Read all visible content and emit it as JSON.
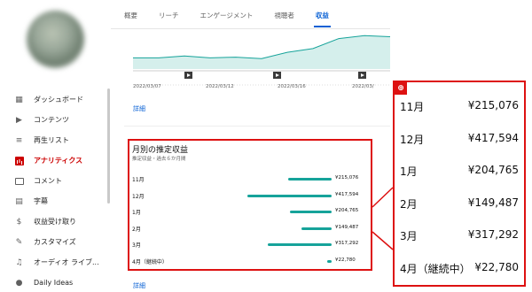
{
  "sidebar": {
    "items": [
      {
        "label": "ダッシュボード",
        "icon": "dashboard-icon"
      },
      {
        "label": "コンテンツ",
        "icon": "content-icon"
      },
      {
        "label": "再生リスト",
        "icon": "playlist-icon"
      },
      {
        "label": "アナリティクス",
        "icon": "analytics-icon",
        "active": true
      },
      {
        "label": "コメント",
        "icon": "comment-icon"
      },
      {
        "label": "字幕",
        "icon": "subtitles-icon"
      },
      {
        "label": "収益受け取り",
        "icon": "dollar-icon"
      },
      {
        "label": "カスタマイズ",
        "icon": "customize-icon"
      },
      {
        "label": "オーディオ ライブ...",
        "icon": "audio-library-icon"
      },
      {
        "label": "Daily Ideas",
        "icon": "daily-ideas-icon"
      }
    ]
  },
  "tabs": [
    {
      "label": "概要"
    },
    {
      "label": "リーチ"
    },
    {
      "label": "エンゲージメント"
    },
    {
      "label": "視聴者"
    },
    {
      "label": "収益",
      "active": true
    }
  ],
  "chart_data": {
    "type": "area",
    "x_labels": [
      "2022/03/07",
      "2022/03/12",
      "2022/03/16",
      "2022/03/"
    ],
    "series": [
      {
        "values": [
          0.3,
          0.3,
          0.35,
          0.3,
          0.32,
          0.28,
          0.45,
          0.55,
          0.82,
          0.9,
          0.87
        ]
      }
    ],
    "color": "#16a39a"
  },
  "links": {
    "detail_top": "詳細",
    "detail_bottom": "詳細"
  },
  "monthly_card": {
    "title": "月別の推定収益",
    "subtitle": "推定収益・過去６か月間",
    "max_value": 417594,
    "rows": [
      {
        "month": "11月",
        "value": "¥215,076",
        "amount": 215076
      },
      {
        "month": "12月",
        "value": "¥417,594",
        "amount": 417594
      },
      {
        "month": "1月",
        "value": "¥204,765",
        "amount": 204765
      },
      {
        "month": "2月",
        "value": "¥149,487",
        "amount": 149487
      },
      {
        "month": "3月",
        "value": "¥317,292",
        "amount": 317292
      },
      {
        "month": "4月（継続中）",
        "value": "¥22,780",
        "amount": 22780
      }
    ]
  },
  "zoom_panel": {
    "icon": "zoom-in-icon",
    "rows": [
      {
        "month": "11月",
        "value": "¥215,076"
      },
      {
        "month": "12月",
        "value": "¥417,594"
      },
      {
        "month": "1月",
        "value": "¥204,765"
      },
      {
        "month": "2月",
        "value": "¥149,487"
      },
      {
        "month": "3月",
        "value": "¥317,292"
      },
      {
        "month": "4月（継続中）",
        "value": "¥22,780"
      }
    ]
  },
  "colors": {
    "accent": "#065fd4",
    "active": "#cc0000",
    "highlight": "#dd1111",
    "bar": "#16a39a"
  }
}
